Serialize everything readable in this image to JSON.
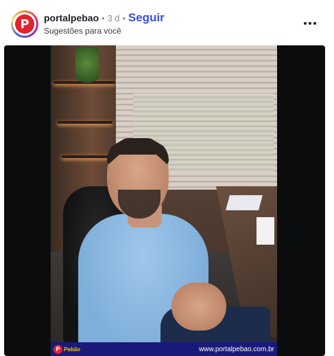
{
  "post": {
    "author": "portalpebao",
    "age": "3 d",
    "separator": "•",
    "follow_label": "Seguir",
    "subtitle": "Sugestões para você",
    "avatar_letter": "P",
    "more_icon": "more-horizontal-icon"
  },
  "video": {
    "banner_logo_letter": "P",
    "banner_brand": "Pebão",
    "banner_url": "www.portalpebao.com.br"
  },
  "colors": {
    "follow": "#3a4fd8",
    "brand_red": "#e0232c",
    "banner_bg": "#1a1a7a"
  }
}
